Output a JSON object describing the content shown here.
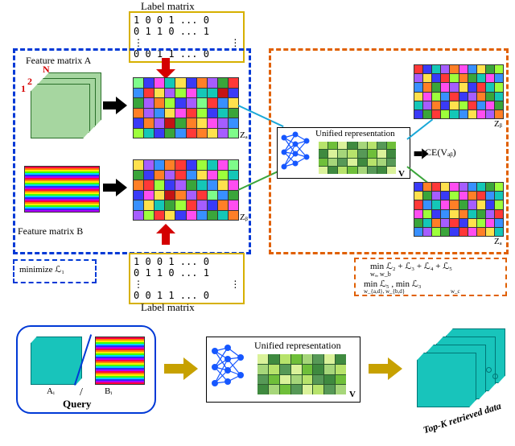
{
  "top_label": "Label matrix",
  "bottom_label": "Label matrix",
  "label_matrix_rows": "1 0 0 1 ... 0\n0 1 1 0 ... 1\n⋮               ⋮\n0 0 1 1 ... 0",
  "feature_A": "Feature matrix  A",
  "feature_B": "Feature matrix  B",
  "N_axis": {
    "one": "1",
    "two": "2",
    "N": "N"
  },
  "Za": "Zₐ",
  "Zb": "Zᵦ",
  "Za2": "Zₐ",
  "Zb2": "Zᵦ",
  "unified": "Unified representation",
  "unified2": "Unified representation",
  "V": "V",
  "V2": "V",
  "CE": "CE(Vₐᵦ)",
  "legend_blue": "minimize  ℒ₁",
  "legend_orange_1": "min  ℒ₂ + ℒ₃ + ℒ₄ + ℒ₅",
  "legend_orange_sub1": "wₐ, w_b",
  "legend_orange_2": "min   ℒ₅ ,  min  ℒ₃",
  "legend_orange_sub2": "w_{a,d}, w_{b,d}",
  "legend_orange_sub3": "w_c",
  "query": "Query",
  "Ai": "Aᵢ",
  "Bi": "Bᵢ",
  "slash": "/",
  "topk": "Top-K  retrieved  data"
}
